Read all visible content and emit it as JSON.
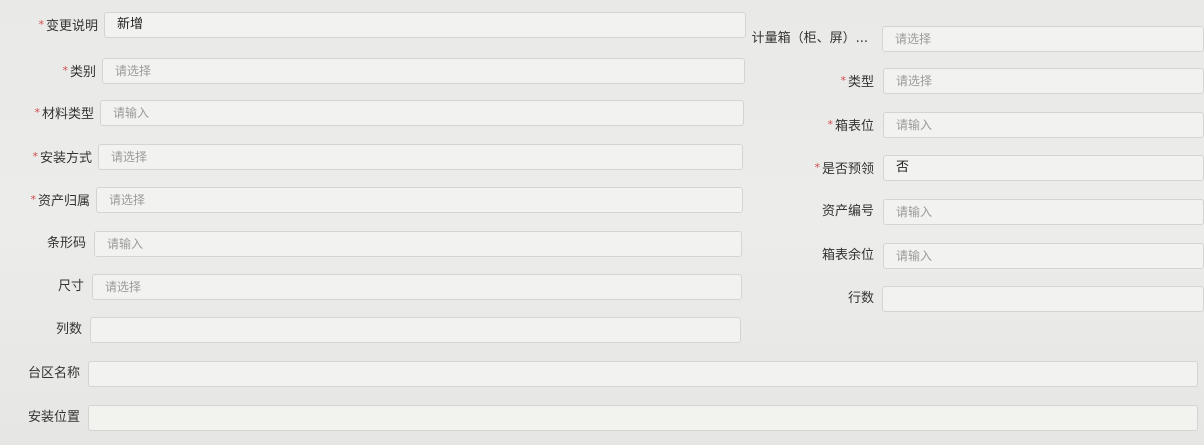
{
  "left_fields": [
    {
      "label": "变更说明",
      "required": true,
      "value": "新增",
      "placeholder": ""
    },
    {
      "label": "类别",
      "required": true,
      "value": "",
      "placeholder": "请选择"
    },
    {
      "label": "材料类型",
      "required": true,
      "value": "",
      "placeholder": "请输入"
    },
    {
      "label": "安装方式",
      "required": true,
      "value": "",
      "placeholder": "请选择"
    },
    {
      "label": "资产归属",
      "required": true,
      "value": "",
      "placeholder": "请选择"
    },
    {
      "label": "条形码",
      "required": false,
      "value": "",
      "placeholder": "请输入"
    },
    {
      "label": "尺寸",
      "required": false,
      "value": "",
      "placeholder": "请选择"
    },
    {
      "label": "列数",
      "required": false,
      "value": "",
      "placeholder": ""
    }
  ],
  "right_fields": [
    {
      "label": "计量箱（柜、屏）...",
      "required": false,
      "value": "",
      "placeholder": "请选择"
    },
    {
      "label": "类型",
      "required": true,
      "value": "",
      "placeholder": "请选择"
    },
    {
      "label": "箱表位",
      "required": true,
      "value": "",
      "placeholder": "请输入"
    },
    {
      "label": "是否预领",
      "required": true,
      "value": "否",
      "placeholder": ""
    },
    {
      "label": "资产编号",
      "required": false,
      "value": "",
      "placeholder": "请输入"
    },
    {
      "label": "箱表余位",
      "required": false,
      "value": "",
      "placeholder": "请输入"
    },
    {
      "label": "行数",
      "required": false,
      "value": "",
      "placeholder": ""
    }
  ],
  "full_fields": [
    {
      "label": "台区名称",
      "required": false,
      "value": "",
      "placeholder": ""
    },
    {
      "label": "安装位置",
      "required": false,
      "value": "",
      "placeholder": ""
    }
  ],
  "required_marker": "*"
}
